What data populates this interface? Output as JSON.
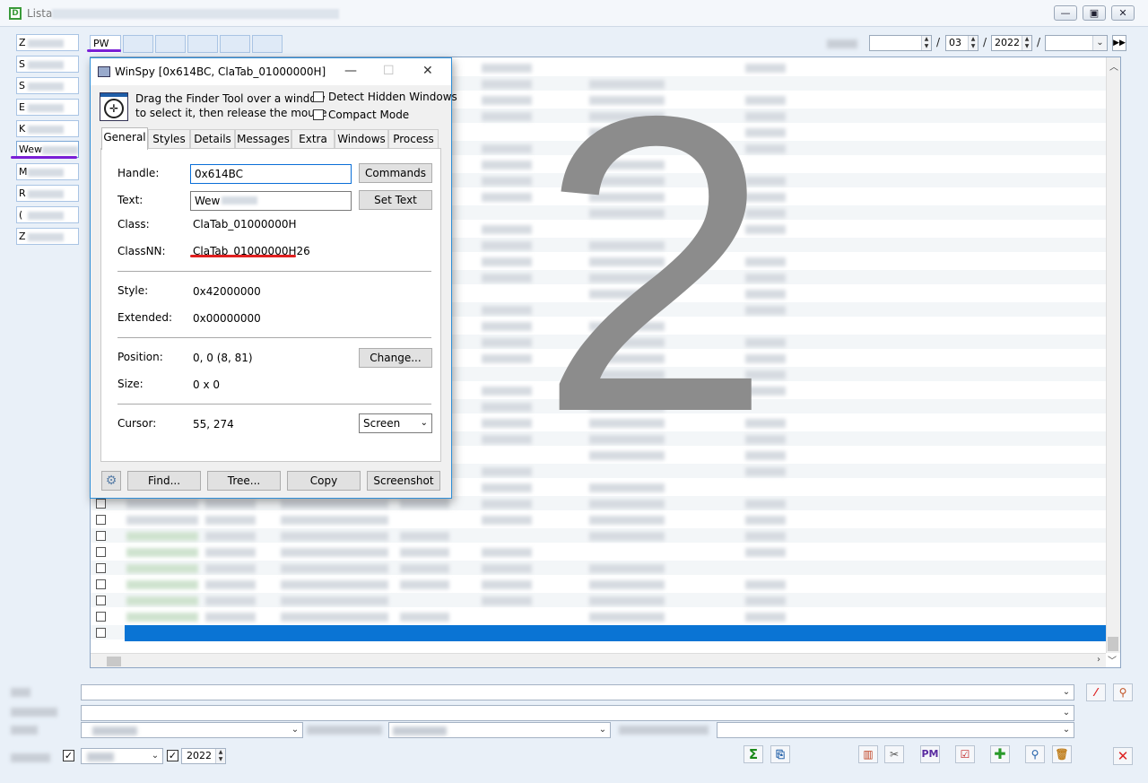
{
  "window": {
    "title": "Lista",
    "min_label": "—",
    "max_label": "▣",
    "close_label": "✕"
  },
  "left_list": [
    {
      "label": "Z"
    },
    {
      "label": "S"
    },
    {
      "label": "S"
    },
    {
      "label": "E"
    },
    {
      "label": "K"
    },
    {
      "label": "Wew"
    },
    {
      "label": "M"
    },
    {
      "label": "R"
    },
    {
      "label": "("
    },
    {
      "label": "Z"
    }
  ],
  "top_tabs": [
    {
      "label": "PW"
    }
  ],
  "date": {
    "month": "03",
    "year": "2022",
    "sep": "/"
  },
  "overlay": {
    "number": "2"
  },
  "winspy": {
    "title": "WinSpy [0x614BC, ClaTab_01000000H]",
    "instructions_line1": "Drag the Finder Tool over a window",
    "instructions_line2": "to select it, then release the mouse",
    "detect_hidden": "Detect Hidden Windows",
    "compact_mode": "Compact Mode",
    "tabs": [
      "General",
      "Styles",
      "Details",
      "Messages",
      "Extra",
      "Windows",
      "Process"
    ],
    "fields": {
      "handle_label": "Handle:",
      "handle_value": "0x614BC",
      "text_label": "Text:",
      "text_value": "Wew",
      "class_label": "Class:",
      "class_value": "ClaTab_01000000H",
      "classnn_label": "ClassNN:",
      "classnn_value": "ClaTab_01000000H26",
      "style_label": "Style:",
      "style_value": "0x42000000",
      "extended_label": "Extended:",
      "extended_value": "0x00000000",
      "position_label": "Position:",
      "position_value": "0, 0 (8, 81)",
      "size_label": "Size:",
      "size_value": "0 x 0",
      "cursor_label": "Cursor:",
      "cursor_value": "55, 274"
    },
    "buttons": {
      "commands": "Commands",
      "set_text": "Set Text",
      "change": "Change...",
      "screen": "Screen",
      "find": "Find...",
      "tree": "Tree...",
      "copy": "Copy",
      "screenshot": "Screenshot"
    }
  },
  "bottom": {
    "year": "2022"
  },
  "colors": {
    "accent": "#0a74d4",
    "underline_purple": "#7a1fd6",
    "underline_red": "#e02020"
  }
}
